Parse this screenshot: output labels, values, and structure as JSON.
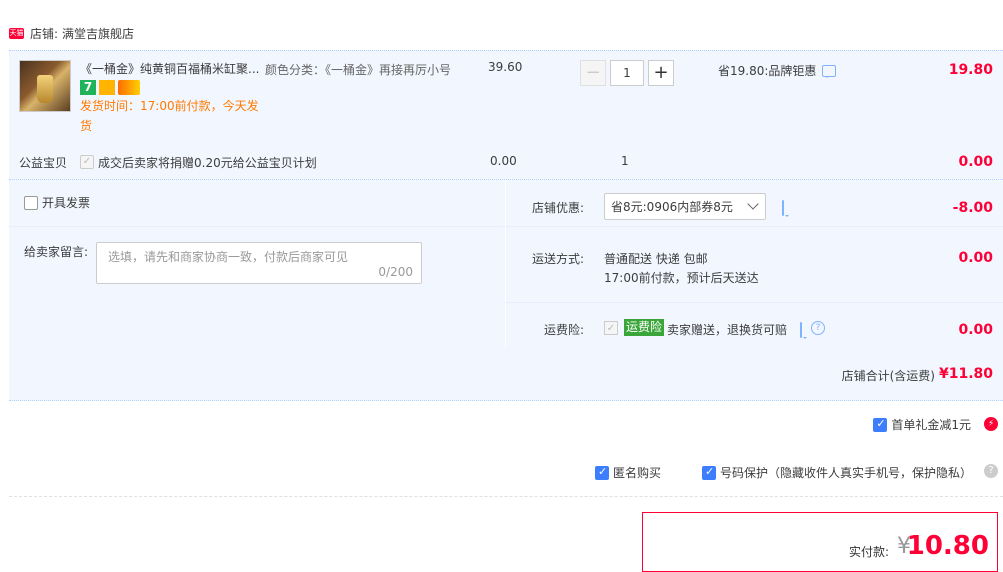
{
  "shop": {
    "badge": "天猫",
    "label": "店铺:",
    "name": "满堂吉旗舰店"
  },
  "item": {
    "title": "《一桶金》纯黄铜百福桶米缸聚...",
    "shipping_note": "发货时间：17:00前付款，今天发货",
    "spec": "颜色分类：《一桶金》再接再厉小号",
    "unit_price": "39.60",
    "qty_minus": "−",
    "qty_value": "1",
    "qty_plus": "+",
    "promo": "省19.80:品牌钜惠",
    "subtotal": "19.80",
    "icon7": "7"
  },
  "charity": {
    "label": "公益宝贝",
    "text": "成交后卖家将捐赠0.20元给公益宝贝计划",
    "price": "0.00",
    "qty": "1",
    "subtotal": "0.00"
  },
  "invoice": {
    "label": "开具发票"
  },
  "message": {
    "label": "给卖家留言:",
    "placeholder": "选填，请先和商家协商一致，付款后商家可见",
    "counter": "0/200"
  },
  "shop_discount": {
    "label": "店铺优惠:",
    "selected": "省8元:0906内部券8元",
    "value": "-8.00"
  },
  "delivery": {
    "label": "运送方式:",
    "line1": "普通配送 快递 包邮",
    "line2": "17:00前付款，预计后天送达",
    "value": "0.00"
  },
  "insurance": {
    "label": "运费险:",
    "badge": "运费险",
    "text": "卖家赠送，退换货可赔",
    "value": "0.00"
  },
  "shop_total": {
    "label": "店铺合计(含运费)",
    "value": "¥11.80"
  },
  "options": {
    "gift": "首单礼金减1元",
    "anonymous": "匿名购买",
    "privacy": "号码保护（隐藏收件人真实手机号，保护隐私）"
  },
  "payment": {
    "label": "实付款:",
    "currency": "¥",
    "value": "10.80"
  },
  "colors": {
    "accent_red": "#ff0036",
    "blue_bg": "#f2f7ff",
    "check_blue": "#3d7eff"
  }
}
